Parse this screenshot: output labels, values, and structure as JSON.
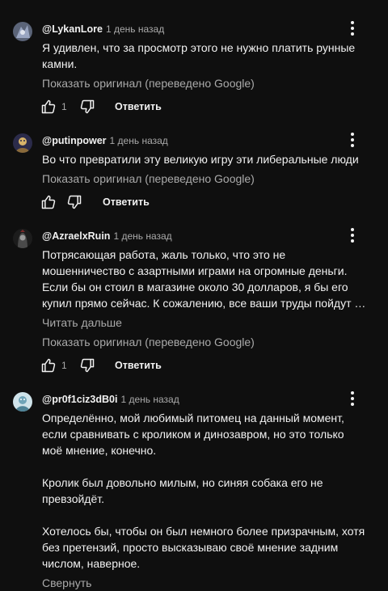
{
  "comments": [
    {
      "author": "@LykanLore",
      "time": "1 день назад",
      "text": [
        "Я удивлен, что за просмотр этого не нужно платить рунные",
        "камни."
      ],
      "translate_link": "Показать оригинал (переведено Google)",
      "likes": "1",
      "reply_label": "Ответить",
      "avatar_color": "#7b86a6"
    },
    {
      "author": "@putinpower",
      "time": "1 день назад",
      "text": [
        "Во что превратили эту великую игру эти либеральные люди"
      ],
      "translate_link": "Показать оригинал (переведено Google)",
      "likes": "",
      "reply_label": "Ответить",
      "avatar_color": "#c9a24a"
    },
    {
      "author": "@AzraelxRuin",
      "time": "1 день назад",
      "text": [
        "Потрясающая работа, жаль только, что это не",
        "мошенничество с азартными играми на огромные деньги.",
        "Если бы он стоил в магазине около 30 долларов, я бы его",
        "купил прямо сейчас. К сожалению, все ваши труды пойдут …"
      ],
      "read_more": "Читать дальше",
      "translate_link": "Показать оригинал (переведено Google)",
      "likes": "1",
      "reply_label": "Ответить",
      "avatar_color": "#3a3a3a"
    },
    {
      "author": "@pr0f1ciz3dB0i",
      "time": "1 день назад",
      "paragraphs": [
        [
          "Определённо, мой любимый питомец на данный момент,",
          "если сравнивать с кроликом и динозавром, но это только",
          "моё мнение, конечно."
        ],
        [
          "Кролик был довольно милым, но синяя собака его не",
          "превзойдёт."
        ],
        [
          "Хотелось бы, чтобы он был немного более призрачным, хотя",
          "без претензий, просто высказываю своё мнение задним",
          "числом, наверное."
        ]
      ],
      "collapse_link": "Свернуть",
      "avatar_color": "#8ab7c9"
    }
  ],
  "colors": {
    "background": "#0f0f0f",
    "text": "#f1f1f1",
    "secondary": "#aaaaaa"
  }
}
